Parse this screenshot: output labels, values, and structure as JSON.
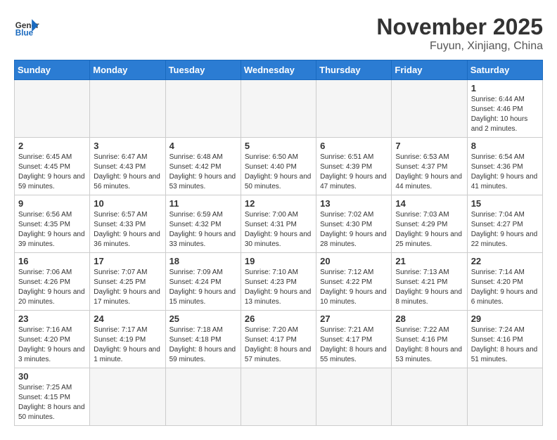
{
  "header": {
    "logo_general": "General",
    "logo_blue": "Blue",
    "month_title": "November 2025",
    "location": "Fuyun, Xinjiang, China"
  },
  "weekdays": [
    "Sunday",
    "Monday",
    "Tuesday",
    "Wednesday",
    "Thursday",
    "Friday",
    "Saturday"
  ],
  "weeks": [
    [
      {
        "day": "",
        "info": ""
      },
      {
        "day": "",
        "info": ""
      },
      {
        "day": "",
        "info": ""
      },
      {
        "day": "",
        "info": ""
      },
      {
        "day": "",
        "info": ""
      },
      {
        "day": "",
        "info": ""
      },
      {
        "day": "1",
        "info": "Sunrise: 6:44 AM\nSunset: 4:46 PM\nDaylight: 10 hours\nand 2 minutes."
      }
    ],
    [
      {
        "day": "2",
        "info": "Sunrise: 6:45 AM\nSunset: 4:45 PM\nDaylight: 9 hours\nand 59 minutes."
      },
      {
        "day": "3",
        "info": "Sunrise: 6:47 AM\nSunset: 4:43 PM\nDaylight: 9 hours\nand 56 minutes."
      },
      {
        "day": "4",
        "info": "Sunrise: 6:48 AM\nSunset: 4:42 PM\nDaylight: 9 hours\nand 53 minutes."
      },
      {
        "day": "5",
        "info": "Sunrise: 6:50 AM\nSunset: 4:40 PM\nDaylight: 9 hours\nand 50 minutes."
      },
      {
        "day": "6",
        "info": "Sunrise: 6:51 AM\nSunset: 4:39 PM\nDaylight: 9 hours\nand 47 minutes."
      },
      {
        "day": "7",
        "info": "Sunrise: 6:53 AM\nSunset: 4:37 PM\nDaylight: 9 hours\nand 44 minutes."
      },
      {
        "day": "8",
        "info": "Sunrise: 6:54 AM\nSunset: 4:36 PM\nDaylight: 9 hours\nand 41 minutes."
      }
    ],
    [
      {
        "day": "9",
        "info": "Sunrise: 6:56 AM\nSunset: 4:35 PM\nDaylight: 9 hours\nand 39 minutes."
      },
      {
        "day": "10",
        "info": "Sunrise: 6:57 AM\nSunset: 4:33 PM\nDaylight: 9 hours\nand 36 minutes."
      },
      {
        "day": "11",
        "info": "Sunrise: 6:59 AM\nSunset: 4:32 PM\nDaylight: 9 hours\nand 33 minutes."
      },
      {
        "day": "12",
        "info": "Sunrise: 7:00 AM\nSunset: 4:31 PM\nDaylight: 9 hours\nand 30 minutes."
      },
      {
        "day": "13",
        "info": "Sunrise: 7:02 AM\nSunset: 4:30 PM\nDaylight: 9 hours\nand 28 minutes."
      },
      {
        "day": "14",
        "info": "Sunrise: 7:03 AM\nSunset: 4:29 PM\nDaylight: 9 hours\nand 25 minutes."
      },
      {
        "day": "15",
        "info": "Sunrise: 7:04 AM\nSunset: 4:27 PM\nDaylight: 9 hours\nand 22 minutes."
      }
    ],
    [
      {
        "day": "16",
        "info": "Sunrise: 7:06 AM\nSunset: 4:26 PM\nDaylight: 9 hours\nand 20 minutes."
      },
      {
        "day": "17",
        "info": "Sunrise: 7:07 AM\nSunset: 4:25 PM\nDaylight: 9 hours\nand 17 minutes."
      },
      {
        "day": "18",
        "info": "Sunrise: 7:09 AM\nSunset: 4:24 PM\nDaylight: 9 hours\nand 15 minutes."
      },
      {
        "day": "19",
        "info": "Sunrise: 7:10 AM\nSunset: 4:23 PM\nDaylight: 9 hours\nand 13 minutes."
      },
      {
        "day": "20",
        "info": "Sunrise: 7:12 AM\nSunset: 4:22 PM\nDaylight: 9 hours\nand 10 minutes."
      },
      {
        "day": "21",
        "info": "Sunrise: 7:13 AM\nSunset: 4:21 PM\nDaylight: 9 hours\nand 8 minutes."
      },
      {
        "day": "22",
        "info": "Sunrise: 7:14 AM\nSunset: 4:20 PM\nDaylight: 9 hours\nand 6 minutes."
      }
    ],
    [
      {
        "day": "23",
        "info": "Sunrise: 7:16 AM\nSunset: 4:20 PM\nDaylight: 9 hours\nand 3 minutes."
      },
      {
        "day": "24",
        "info": "Sunrise: 7:17 AM\nSunset: 4:19 PM\nDaylight: 9 hours\nand 1 minute."
      },
      {
        "day": "25",
        "info": "Sunrise: 7:18 AM\nSunset: 4:18 PM\nDaylight: 8 hours\nand 59 minutes."
      },
      {
        "day": "26",
        "info": "Sunrise: 7:20 AM\nSunset: 4:17 PM\nDaylight: 8 hours\nand 57 minutes."
      },
      {
        "day": "27",
        "info": "Sunrise: 7:21 AM\nSunset: 4:17 PM\nDaylight: 8 hours\nand 55 minutes."
      },
      {
        "day": "28",
        "info": "Sunrise: 7:22 AM\nSunset: 4:16 PM\nDaylight: 8 hours\nand 53 minutes."
      },
      {
        "day": "29",
        "info": "Sunrise: 7:24 AM\nSunset: 4:16 PM\nDaylight: 8 hours\nand 51 minutes."
      }
    ],
    [
      {
        "day": "30",
        "info": "Sunrise: 7:25 AM\nSunset: 4:15 PM\nDaylight: 8 hours\nand 50 minutes."
      },
      {
        "day": "",
        "info": ""
      },
      {
        "day": "",
        "info": ""
      },
      {
        "day": "",
        "info": ""
      },
      {
        "day": "",
        "info": ""
      },
      {
        "day": "",
        "info": ""
      },
      {
        "day": "",
        "info": ""
      }
    ]
  ]
}
